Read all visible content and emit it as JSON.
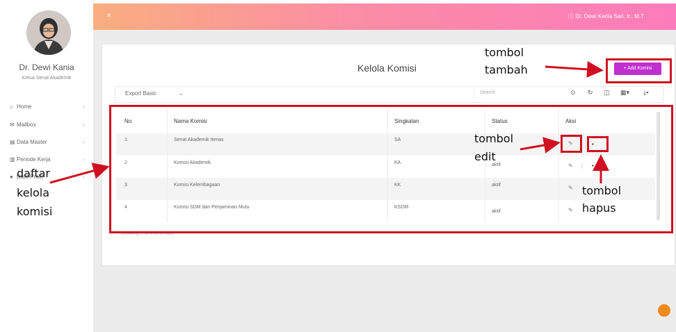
{
  "sidebar": {
    "user_name": "Dr. Dewi Kania",
    "user_role": "Ketua Senat Akademik",
    "items": [
      {
        "label": "Home",
        "icon": "home-icon"
      },
      {
        "label": "Mailbox",
        "icon": "envelope-icon"
      },
      {
        "label": "Data Master",
        "icon": "database-icon"
      },
      {
        "label": "Periode Kerja",
        "icon": "bar-chart-icon"
      },
      {
        "label": "Data Profil",
        "icon": "user-icon"
      }
    ]
  },
  "topbar": {
    "menu_icon": "menu-icon",
    "user": "Dr. Dewi Kania Sari, Ir., M.T"
  },
  "page": {
    "title": "Kelola Komisi",
    "add_button": "+ Add Komisi",
    "export_label": "Export Basic",
    "search_placeholder": "Search",
    "showing": "Showing 1 to 4 of 4 rows"
  },
  "table": {
    "columns": [
      "No",
      "Nama Komisi",
      "Singkatan",
      "Status",
      "Aksi"
    ],
    "rows": [
      {
        "no": "1",
        "nama": "Senat Akademik Itenas",
        "singkatan": "SA",
        "status": "aktif"
      },
      {
        "no": "2",
        "nama": "Komisi Akademik",
        "singkatan": "KA",
        "status": "aktif"
      },
      {
        "no": "3",
        "nama": "Komisi Kelembagaan",
        "singkatan": "KK",
        "status": "aktif"
      },
      {
        "no": "4",
        "nama": "Komisi SDM dan Penjaminan Mutu",
        "singkatan": "KSDM",
        "status": "aktif"
      }
    ]
  },
  "annotations": {
    "tambah_line1": "tombol",
    "tambah_line2": "tambah",
    "edit_line1": "tombol",
    "edit_line2": "edit",
    "hapus_line1": "tombol",
    "hapus_line2": "hapus",
    "daftar_line1": "daftar",
    "daftar_line2": "kelola",
    "daftar_line3": "komisi"
  },
  "colors": {
    "accent": "#c02fcf",
    "annotation_red": "#d01020",
    "topbar_start": "#f9ae7f",
    "topbar_end": "#fb7cbb"
  }
}
